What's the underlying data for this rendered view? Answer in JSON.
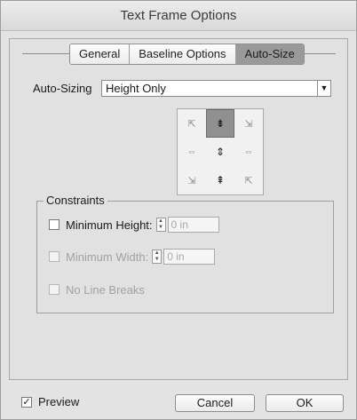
{
  "dialog": {
    "title": "Text Frame Options"
  },
  "tabs": [
    {
      "label": "General"
    },
    {
      "label": "Baseline Options"
    },
    {
      "label": "Auto-Size",
      "active": true
    }
  ],
  "auto_sizing": {
    "label": "Auto-Sizing",
    "value": "Height Only"
  },
  "reference_grid": {
    "selected": "top-center",
    "icons": [
      "⇱",
      "⇟",
      "⇲",
      "⇔",
      "⇕",
      "⇔",
      "⇲",
      "⇞",
      "⇱"
    ]
  },
  "constraints": {
    "legend": "Constraints",
    "minimum_height": {
      "label": "Minimum Height:",
      "value": "0 in",
      "checked": false,
      "enabled": true
    },
    "minimum_width": {
      "label": "Minimum Width:",
      "value": "0 in",
      "checked": false,
      "enabled": false
    },
    "no_line_breaks": {
      "label": "No Line Breaks",
      "checked": false,
      "enabled": false
    }
  },
  "footer": {
    "preview_label": "Preview",
    "preview_checked": true,
    "cancel_label": "Cancel",
    "ok_label": "OK"
  },
  "icons": {
    "dropdown": "chevron-down-icon",
    "checkmark": "check-icon",
    "stepper": "stepper-icon"
  }
}
